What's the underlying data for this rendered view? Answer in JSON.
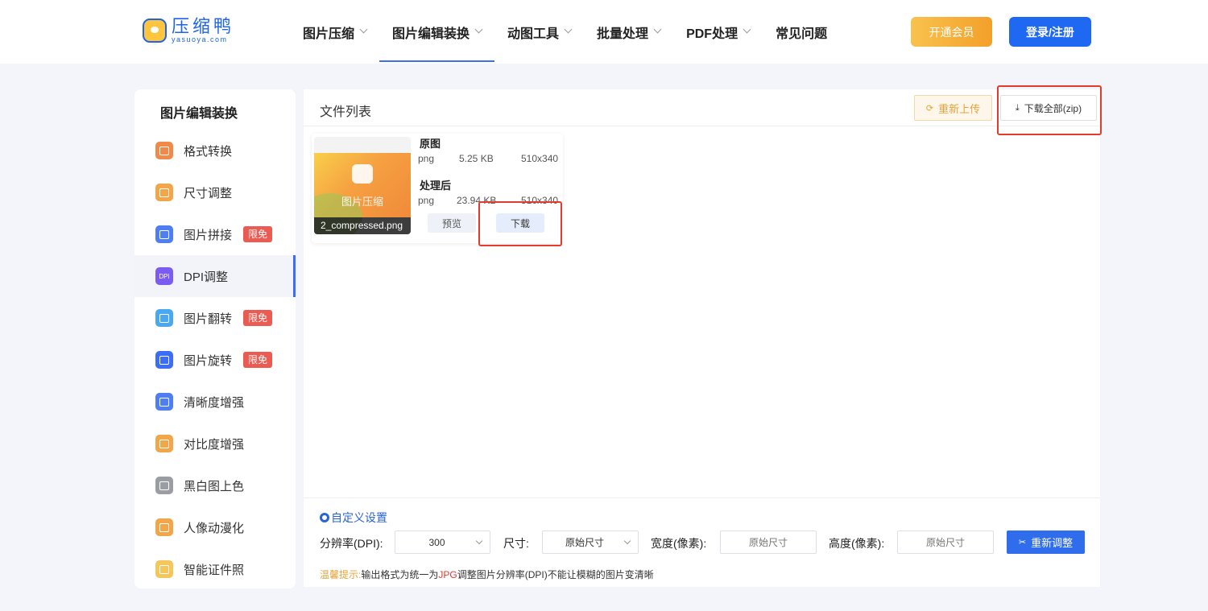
{
  "logo": {
    "cn": "压缩鸭",
    "en": "yasuoya.com"
  },
  "nav": [
    {
      "label": "图片压缩",
      "has_dropdown": true
    },
    {
      "label": "图片编辑装换",
      "has_dropdown": true
    },
    {
      "label": "动图工具",
      "has_dropdown": true
    },
    {
      "label": "批量处理",
      "has_dropdown": true
    },
    {
      "label": "PDF处理",
      "has_dropdown": true
    },
    {
      "label": "常见问题",
      "has_dropdown": false
    }
  ],
  "header_buttons": {
    "vip": "开通会员",
    "login": "登录/注册"
  },
  "sidebar": {
    "title": "图片编辑装换",
    "items": [
      {
        "label": "格式转换",
        "icon": "format-convert-icon",
        "color": "#f08a4b"
      },
      {
        "label": "尺寸调整",
        "icon": "crop-icon",
        "color": "#f1a64a"
      },
      {
        "label": "图片拼接",
        "icon": "collage-icon",
        "color": "#4f7ef0",
        "badge": "限免"
      },
      {
        "label": "DPI调整",
        "icon": "dpi-icon",
        "color": "#7b5cf0",
        "icon_text": "DPI"
      },
      {
        "label": "图片翻转",
        "icon": "flip-icon",
        "color": "#4aa8f0",
        "badge": "限免"
      },
      {
        "label": "图片旋转",
        "icon": "rotate-icon",
        "color": "#3b6ef5",
        "badge": "限免"
      },
      {
        "label": "清晰度增强",
        "icon": "hd-icon",
        "color": "#4f7ef0"
      },
      {
        "label": "对比度增强",
        "icon": "contrast-icon",
        "color": "#f1a64a"
      },
      {
        "label": "黑白图上色",
        "icon": "colorize-icon",
        "color": "#9a9da3"
      },
      {
        "label": "人像动漫化",
        "icon": "anime-icon",
        "color": "#f1a64a"
      },
      {
        "label": "智能证件照",
        "icon": "id-photo-icon",
        "color": "#f5c65a"
      }
    ],
    "active_index": 3
  },
  "main": {
    "title": "文件列表",
    "reupload": "重新上传",
    "download_all": "下载全部(zip)",
    "file": {
      "thumb_label": "图片压缩",
      "name": "2_compressed.png",
      "original_label": "原图",
      "original": {
        "format": "png",
        "size": "5.25 KB",
        "dims": "510x340"
      },
      "processed_label": "处理后",
      "processed": {
        "format": "png",
        "size": "23.94 KB",
        "dims": "510x340"
      },
      "preview_btn": "预览",
      "download_btn": "下载"
    }
  },
  "settings": {
    "title": "自定义设置",
    "dpi_label": "分辨率(DPI):",
    "dpi_value": "300",
    "size_label": "尺寸:",
    "size_value": "原始尺寸",
    "width_label": "宽度(像素):",
    "width_placeholder": "原始尺寸",
    "height_label": "高度(像素):",
    "height_placeholder": "原始尺寸",
    "readjust_btn": "重新调整",
    "tip_prefix": "温馨提示:",
    "tip_part1": "输出格式为统一为",
    "tip_jpg": "JPG",
    "tip_part2": "调整图片分辨率(DPI)不能让模糊的图片变清晰"
  }
}
